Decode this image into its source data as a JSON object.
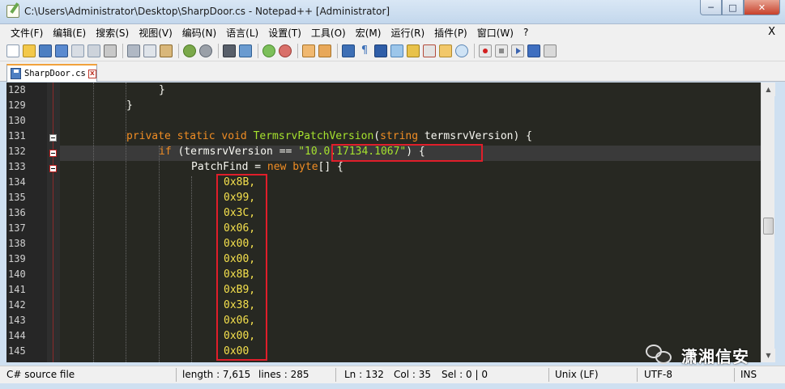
{
  "window": {
    "title": "C:\\Users\\Administrator\\Desktop\\SharpDoor.cs - Notepad++ [Administrator]",
    "minimize": "─",
    "maximize": "□",
    "close": "✕"
  },
  "menu": {
    "items": [
      "文件(F)",
      "编辑(E)",
      "搜索(S)",
      "视图(V)",
      "编码(N)",
      "语言(L)",
      "设置(T)",
      "工具(O)",
      "宏(M)",
      "运行(R)",
      "插件(P)",
      "窗口(W)",
      "?"
    ],
    "close": "X"
  },
  "tab": {
    "label": "SharpDoor.cs",
    "close": "x"
  },
  "editor": {
    "current_line_number": "132",
    "lines": [
      {
        "no": "128",
        "text": "}"
      },
      {
        "no": "129",
        "text": "}"
      },
      {
        "no": "130",
        "text": ""
      },
      {
        "no": "131",
        "text": "private static void TermsrvPatchVersion(string termsrvVersion) {"
      },
      {
        "no": "132",
        "text": "if (termsrvVersion == \"10.0.17134.1067\") {"
      },
      {
        "no": "133",
        "text": "PatchFind = new byte[] {"
      },
      {
        "no": "134",
        "text": "0x8B,"
      },
      {
        "no": "135",
        "text": "0x99,"
      },
      {
        "no": "136",
        "text": "0x3C,"
      },
      {
        "no": "137",
        "text": "0x06,"
      },
      {
        "no": "138",
        "text": "0x00,"
      },
      {
        "no": "139",
        "text": "0x00,"
      },
      {
        "no": "140",
        "text": "0x8B,"
      },
      {
        "no": "141",
        "text": "0xB9,"
      },
      {
        "no": "142",
        "text": "0x38,"
      },
      {
        "no": "143",
        "text": "0x06,"
      },
      {
        "no": "144",
        "text": "0x00,"
      },
      {
        "no": "145",
        "text": "0x00"
      }
    ],
    "highlighted_string": "\"10.0.17134.1067\"",
    "highlighted_bytes": [
      "0x8B,",
      "0x99,",
      "0x3C,",
      "0x06,",
      "0x00,",
      "0x00,",
      "0x8B,",
      "0xB9,",
      "0x38,",
      "0x06,",
      "0x00,",
      "0x00"
    ]
  },
  "watermark": {
    "text": "潇湘信安"
  },
  "status": {
    "language": "C# source file",
    "length": "length : 7,615",
    "lines": "lines : 285",
    "ln": "Ln : 132",
    "col": "Col : 35",
    "sel": "Sel : 0 | 0",
    "eol": "Unix (LF)",
    "encoding": "UTF-8",
    "mode": "INS"
  },
  "colors": {
    "editor_bg": "#272822",
    "keyword": "#f08d24",
    "number": "#f4e04d",
    "string": "#a6e22e",
    "highlight_box": "#e01e2a"
  }
}
